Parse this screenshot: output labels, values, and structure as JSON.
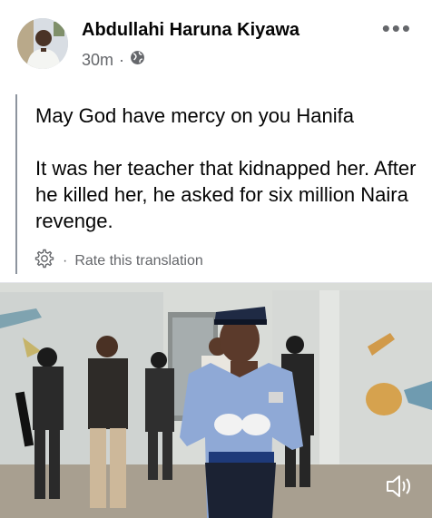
{
  "post": {
    "author": "Abdullahi Haruna Kiyawa",
    "time": "30m",
    "separator": "·",
    "privacy_icon": "globe-icon",
    "more_icon": "more-horizontal-icon",
    "text_line_1": "May God have mercy on you Hanifa",
    "text_line_2": "It was her teacher that kidnapped her. After he killed her, he asked for six million Naira revenge."
  },
  "translation": {
    "settings_icon": "gear-icon",
    "separator": "·",
    "rate_label": "Rate this translation"
  },
  "video": {
    "sound_icon": "speaker-muted-icon"
  },
  "colors": {
    "text_primary": "#050505",
    "text_secondary": "#65676b",
    "police_shirt": "#8fa9d6",
    "police_cap": "#1f2a44"
  }
}
